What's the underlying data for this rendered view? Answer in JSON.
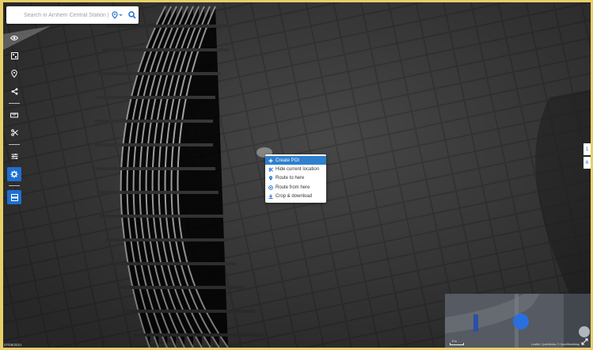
{
  "search": {
    "placeholder": "Search in Arnhem Central Station |..."
  },
  "toolbar": {
    "items": [
      {
        "icon": "eye-icon",
        "active": false
      },
      {
        "icon": "layers-icon",
        "active": false
      },
      {
        "icon": "map-pin-icon",
        "active": false
      },
      {
        "icon": "share-icon",
        "active": false
      },
      {
        "icon": "ruler-icon",
        "active": false
      },
      {
        "icon": "scissors-icon",
        "active": false
      },
      {
        "icon": "sliders-icon",
        "active": false
      },
      {
        "icon": "settings-icon",
        "active": true
      },
      {
        "icon": "panel-icon",
        "active": true
      }
    ]
  },
  "context_menu": {
    "items": [
      {
        "label": "Create POI",
        "icon": "plus-icon"
      },
      {
        "label": "Hide current location",
        "icon": "hide-location-icon"
      },
      {
        "label": "Route to here",
        "icon": "pin-icon"
      },
      {
        "label": "Route from here",
        "icon": "target-icon"
      },
      {
        "label": "Crop & download",
        "icon": "download-icon"
      }
    ]
  },
  "right_tabs": [
    "1",
    "6"
  ],
  "minimap": {
    "attribution": "Leaflet, CycloMedia, © OpenStreetMap",
    "scale_label": "5 m"
  },
  "date_stamp": "07/09/2021",
  "colors": {
    "accent": "#1f6fd0",
    "menu_selected": "#2f80ce",
    "frame": "#e8cf68"
  }
}
